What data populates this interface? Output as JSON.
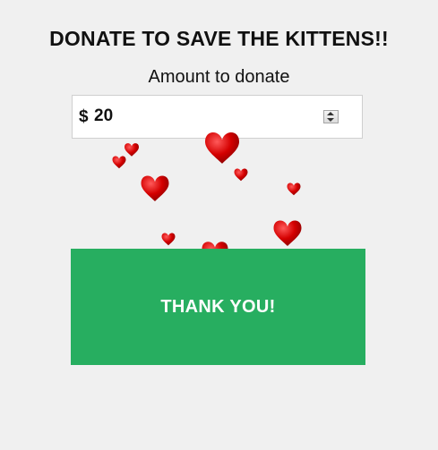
{
  "page": {
    "title": "DONATE TO SAVE THE KITTENS!!"
  },
  "donation": {
    "label": "Amount to donate",
    "currency_symbol": "$",
    "amount_value": "20"
  },
  "thank_button": {
    "label": "THANK YOU!",
    "color": "#27ae60"
  },
  "decoration": {
    "icon": "heart-icon",
    "heart_color": "#d10000"
  }
}
